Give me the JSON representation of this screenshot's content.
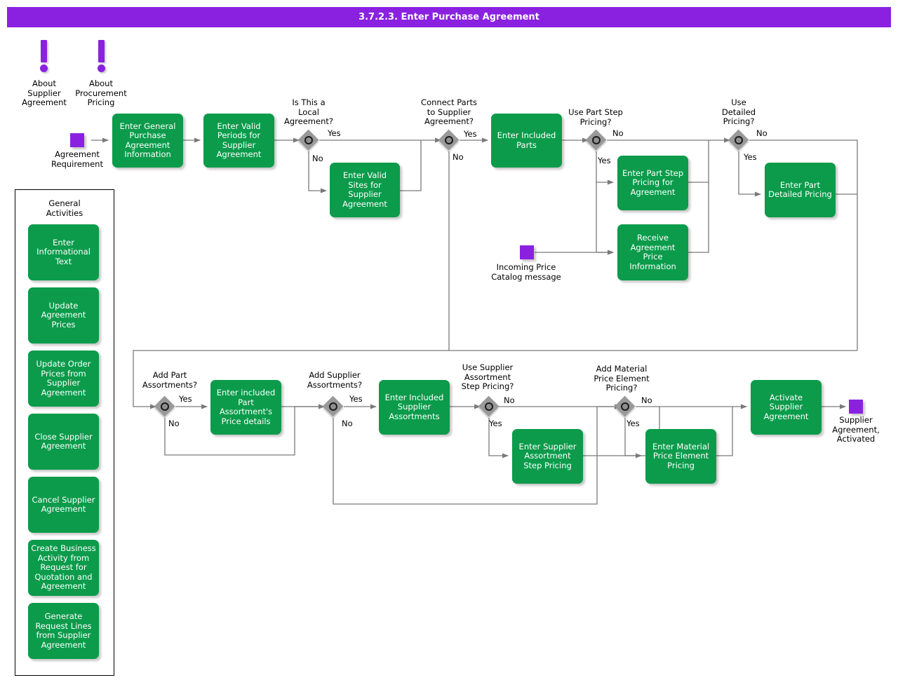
{
  "titlebar": {
    "title": "3.7.2.3. Enter Purchase Agreement"
  },
  "colors": {
    "accent_purple": "#8A21E0",
    "activity_green": "#0B9B4B",
    "gateway_gray": "#999999",
    "connector_gray": "#808080",
    "text_white": "#FFFFFF",
    "text_black": "#000000"
  },
  "info_markers": [
    {
      "label": "About\nSupplier\nAgreement",
      "icon": "exclamation-icon"
    },
    {
      "label": "About\nProcurement\nPricing",
      "icon": "exclamation-icon"
    }
  ],
  "events": [
    {
      "id": "start",
      "label": "Agreement\nRequirement",
      "type": "start-event"
    },
    {
      "id": "incoming_price",
      "label": "Incoming Price\nCatalog message",
      "type": "message-event"
    },
    {
      "id": "end",
      "label": "Supplier\nAgreement,\nActivated",
      "type": "end-event"
    }
  ],
  "gateways": [
    {
      "id": "gw_local",
      "question": "Is This a\nLocal\nAgreement?",
      "yes": "Yes",
      "no": "No"
    },
    {
      "id": "gw_connect_parts",
      "question": "Connect Parts\nto Supplier\nAgreement?",
      "yes": "Yes",
      "no": "No"
    },
    {
      "id": "gw_part_step",
      "question": "Use Part Step\nPricing?",
      "yes": "Yes",
      "no": "No"
    },
    {
      "id": "gw_detailed",
      "question": "Use\nDetailed\nPricing?",
      "yes": "Yes",
      "no": "No"
    },
    {
      "id": "gw_part_assort",
      "question": "Add Part\nAssortments?",
      "yes": "Yes",
      "no": "No"
    },
    {
      "id": "gw_supplier_assort",
      "question": "Add Supplier\nAssortments?",
      "yes": "Yes",
      "no": "No"
    },
    {
      "id": "gw_sup_step",
      "question": "Use Supplier\nAssortment\nStep Pricing?",
      "yes": "Yes",
      "no": "No"
    },
    {
      "id": "gw_material",
      "question": "Add Material\nPrice Element\nPricing?",
      "yes": "Yes",
      "no": "No"
    }
  ],
  "activities": [
    {
      "id": "a_general",
      "label": "Enter General\nPurchase\nAgreement\nInformation"
    },
    {
      "id": "a_valid_periods",
      "label": "Enter Valid\nPeriods for\nSupplier\nAgreement"
    },
    {
      "id": "a_valid_sites",
      "label": "Enter Valid Sites\nfor Supplier\nAgreement"
    },
    {
      "id": "a_incl_parts",
      "label": "Enter Included\nParts"
    },
    {
      "id": "a_part_step",
      "label": "Enter Part Step\nPricing for\nAgreement"
    },
    {
      "id": "a_receive_price",
      "label": "Receive\nAgreement Price\nInformation"
    },
    {
      "id": "a_part_detail",
      "label": "Enter Part\nDetailed Pricing"
    },
    {
      "id": "a_part_assort",
      "label": "Enter included\nPart\nAssortment's\nPrice details"
    },
    {
      "id": "a_incl_sup_assort",
      "label": "Enter Included\nSupplier\nAssortments"
    },
    {
      "id": "a_sup_step",
      "label": "Enter Supplier\nAssortment Step\nPricing"
    },
    {
      "id": "a_material",
      "label": "Enter Material\nPrice Element\nPricing"
    },
    {
      "id": "a_activate",
      "label": "Activate\nSupplier\nAgreement"
    }
  ],
  "general_activities": {
    "title": "General\nActivities",
    "items": [
      {
        "id": "g1",
        "label": "Enter\nInformational\nText"
      },
      {
        "id": "g2",
        "label": "Update\nAgreement\nPrices"
      },
      {
        "id": "g3",
        "label": "Update Order\nPrices from\nSupplier\nAgreement"
      },
      {
        "id": "g4",
        "label": "Close Supplier\nAgreement"
      },
      {
        "id": "g5",
        "label": "Cancel Supplier\nAgreement"
      },
      {
        "id": "g6",
        "label": "Create Business\nActivity from\nRequest for\nQuotation and\nAgreement"
      },
      {
        "id": "g7",
        "label": "Generate\nRequest Lines\nfrom Supplier\nAgreement"
      }
    ]
  }
}
